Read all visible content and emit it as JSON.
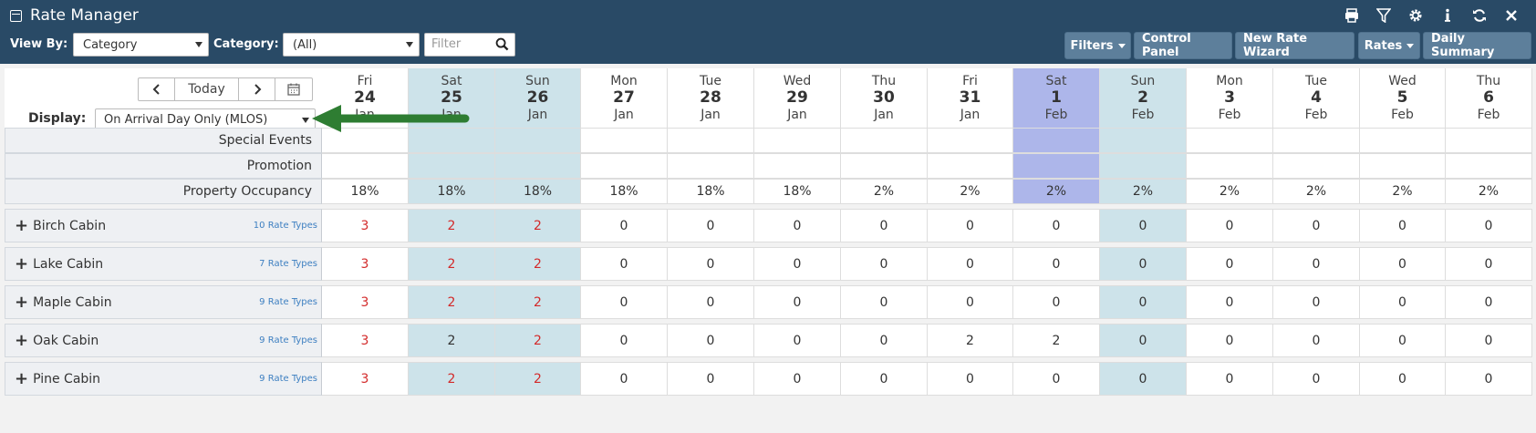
{
  "app": {
    "title": "Rate Manager"
  },
  "filters": {
    "view_by_label": "View By:",
    "view_by_value": "Category",
    "category_label": "Category:",
    "category_value": "(All)",
    "filter_placeholder": "Filter"
  },
  "toolbar": {
    "filters_btn": "Filters",
    "control_panel_btn": "Control Panel",
    "new_rate_wizard_btn": "New Rate Wizard",
    "rates_btn": "Rates",
    "daily_summary_btn": "Daily Summary"
  },
  "top_icons": [
    "print-icon",
    "funnel-icon",
    "gear-icon",
    "info-icon",
    "refresh-icon",
    "close-icon"
  ],
  "nav": {
    "today": "Today"
  },
  "display": {
    "label": "Display:",
    "value": "On Arrival Day Only (MLOS)"
  },
  "dates": [
    {
      "dow": "Fri",
      "day": "24",
      "mon": "Jan",
      "type": "normal"
    },
    {
      "dow": "Sat",
      "day": "25",
      "mon": "Jan",
      "type": "weekend"
    },
    {
      "dow": "Sun",
      "day": "26",
      "mon": "Jan",
      "type": "weekend"
    },
    {
      "dow": "Mon",
      "day": "27",
      "mon": "Jan",
      "type": "normal"
    },
    {
      "dow": "Tue",
      "day": "28",
      "mon": "Jan",
      "type": "normal"
    },
    {
      "dow": "Wed",
      "day": "29",
      "mon": "Jan",
      "type": "normal"
    },
    {
      "dow": "Thu",
      "day": "30",
      "mon": "Jan",
      "type": "normal"
    },
    {
      "dow": "Fri",
      "day": "31",
      "mon": "Jan",
      "type": "normal"
    },
    {
      "dow": "Sat",
      "day": "1",
      "mon": "Feb",
      "type": "highlight"
    },
    {
      "dow": "Sun",
      "day": "2",
      "mon": "Feb",
      "type": "weekend"
    },
    {
      "dow": "Mon",
      "day": "3",
      "mon": "Feb",
      "type": "normal"
    },
    {
      "dow": "Tue",
      "day": "4",
      "mon": "Feb",
      "type": "normal"
    },
    {
      "dow": "Wed",
      "day": "5",
      "mon": "Feb",
      "type": "normal"
    },
    {
      "dow": "Thu",
      "day": "6",
      "mon": "Feb",
      "type": "normal"
    }
  ],
  "info_rows": [
    {
      "label": "Special Events",
      "values": [
        "",
        "",
        "",
        "",
        "",
        "",
        "",
        "",
        "",
        "",
        "",
        "",
        "",
        ""
      ]
    },
    {
      "label": "Promotion",
      "values": [
        "",
        "",
        "",
        "",
        "",
        "",
        "",
        "",
        "",
        "",
        "",
        "",
        "",
        ""
      ]
    },
    {
      "label": "Property Occupancy",
      "values": [
        "18%",
        "18%",
        "18%",
        "18%",
        "18%",
        "18%",
        "2%",
        "2%",
        "2%",
        "2%",
        "2%",
        "2%",
        "2%",
        "2%"
      ]
    }
  ],
  "rooms": [
    {
      "name": "Birch Cabin",
      "rate_types": "10 Rate Types",
      "values": [
        "3",
        "2",
        "2",
        "0",
        "0",
        "0",
        "0",
        "0",
        "0",
        "0",
        "0",
        "0",
        "0",
        "0"
      ],
      "red": [
        true,
        true,
        true,
        false,
        false,
        false,
        false,
        false,
        false,
        false,
        false,
        false,
        false,
        false
      ]
    },
    {
      "name": "Lake Cabin",
      "rate_types": "7 Rate Types",
      "values": [
        "3",
        "2",
        "2",
        "0",
        "0",
        "0",
        "0",
        "0",
        "0",
        "0",
        "0",
        "0",
        "0",
        "0"
      ],
      "red": [
        true,
        true,
        true,
        false,
        false,
        false,
        false,
        false,
        false,
        false,
        false,
        false,
        false,
        false
      ]
    },
    {
      "name": "Maple Cabin",
      "rate_types": "9 Rate Types",
      "values": [
        "3",
        "2",
        "2",
        "0",
        "0",
        "0",
        "0",
        "0",
        "0",
        "0",
        "0",
        "0",
        "0",
        "0"
      ],
      "red": [
        true,
        true,
        true,
        false,
        false,
        false,
        false,
        false,
        false,
        false,
        false,
        false,
        false,
        false
      ]
    },
    {
      "name": "Oak Cabin",
      "rate_types": "9 Rate Types",
      "values": [
        "3",
        "2",
        "2",
        "0",
        "0",
        "0",
        "0",
        "2",
        "2",
        "0",
        "0",
        "0",
        "0",
        "0"
      ],
      "red": [
        true,
        false,
        true,
        false,
        false,
        false,
        false,
        false,
        false,
        false,
        false,
        false,
        false,
        false
      ]
    },
    {
      "name": "Pine Cabin",
      "rate_types": "9 Rate Types",
      "values": [
        "3",
        "2",
        "2",
        "0",
        "0",
        "0",
        "0",
        "0",
        "0",
        "0",
        "0",
        "0",
        "0",
        "0"
      ],
      "red": [
        true,
        true,
        true,
        false,
        false,
        false,
        false,
        false,
        false,
        false,
        false,
        false,
        false,
        false
      ]
    }
  ],
  "colors": {
    "header": "#294a66",
    "weekend": "#cde3ea",
    "highlight": "#adb6ea",
    "restricted_value": "#d32a2a",
    "annotation_arrow": "#2e7d32"
  }
}
